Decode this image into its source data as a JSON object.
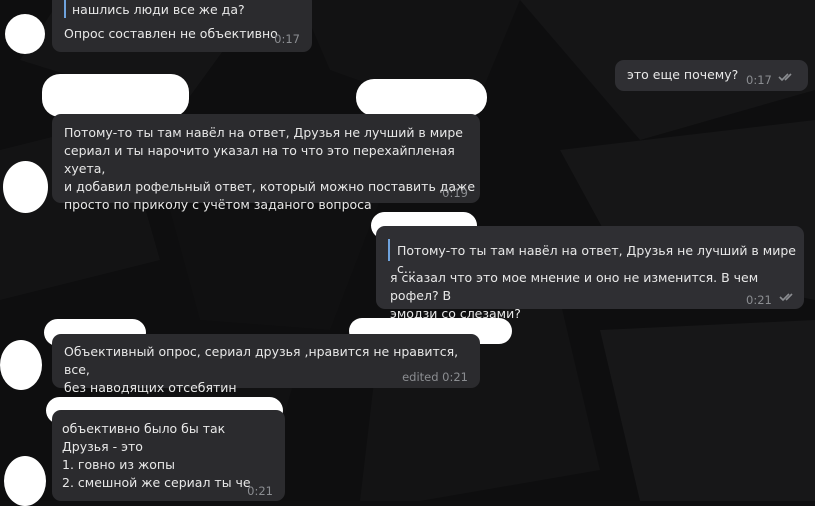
{
  "colors": {
    "background": "#0f0f10",
    "bubble_in": "#2b2b2e",
    "bubble_out": "#2f2f33",
    "text": "#e8e8e8",
    "meta": "#8b8d91",
    "accent": "#6fa3dd"
  },
  "messages": [
    {
      "text": "нашлись люди все же да?"
    },
    {
      "text": "Опрос составлен не объективно",
      "time": "0:17"
    },
    {
      "text": "это еще почему?",
      "time": "0:17"
    },
    {
      "text": "Потому-то ты там навёл на ответ, Друзья не лучший в мире\nсериал и ты нарочито указал на то что это перехайпленая хуета,\nи добавил рофельный ответ, который можно поставить даже\nпросто по приколу с учётом заданого вопроса",
      "time": "0:19"
    },
    {
      "reply": "Потому-то ты там навёл на ответ, Друзья не лучший в мире с...",
      "text": "я сказал что это мое мнение и оно не изменится. В чем рофел? В\nэмодзи со слезами?",
      "time": "0:21"
    },
    {
      "text": "Объективный опрос, сериал друзья ,нравится не нравится, все,\nбез наводящих отсебятин",
      "time": "edited 0:21"
    },
    {
      "text": "объективно было бы так\nДрузья - это\n1. говно из жопы\n2. смешной же сериал ты че",
      "time": "0:21"
    }
  ]
}
